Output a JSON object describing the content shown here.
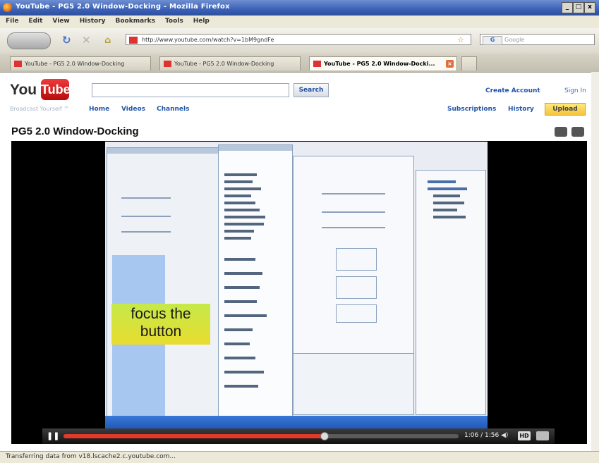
{
  "window": {
    "title": "YouTube - PG5 2.0 Window-Docking - Mozilla Firefox",
    "btn_min": "_",
    "btn_max": "□",
    "btn_close": "x"
  },
  "menu": [
    "File",
    "Edit",
    "View",
    "History",
    "Bookmarks",
    "Tools",
    "Help"
  ],
  "nav": {
    "url": "http://www.youtube.com/watch?v=1bM9gndFe",
    "search_placeholder": "Google",
    "search_engine": "G"
  },
  "tabs": [
    {
      "label": "YouTube - PG5 2.0 Window-Docking",
      "active": false
    },
    {
      "label": "YouTube - PG5 2.0 Window-Docking",
      "active": false
    },
    {
      "label": "YouTube - PG5 2.0 Window-Docki...",
      "active": true
    }
  ],
  "youtube": {
    "logo_you": "You",
    "logo_tube": "Tube",
    "slogan": "Broadcast Yourself ™",
    "search_button": "Search",
    "nav": [
      "Home",
      "Videos",
      "Channels"
    ],
    "create_account": "Create Account",
    "sign_in": "Sign In",
    "subscriptions": "Subscriptions",
    "history": "History",
    "upload": "Upload"
  },
  "video": {
    "title": "PG5 2.0 Window-Docking",
    "caption_line1": "focus the",
    "caption_line2": "button",
    "progress": 0.66,
    "time": "1:06 / 1:56",
    "hd": "HD"
  },
  "status": {
    "text": "Transferring data from v18.lscache2.c.youtube.com..."
  }
}
